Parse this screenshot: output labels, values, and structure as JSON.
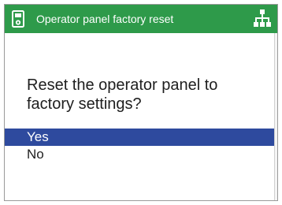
{
  "window": {
    "title": "Operator panel factory reset",
    "title_icon": "device-panel-icon",
    "network_icon": "network-hierarchy-icon",
    "accent_color": "#2e9a4a",
    "selection_color": "#2e4a9e"
  },
  "dialog": {
    "question": "Reset the operator panel to factory settings?",
    "options": [
      {
        "label": "Yes",
        "selected": true
      },
      {
        "label": "No",
        "selected": false
      }
    ]
  }
}
